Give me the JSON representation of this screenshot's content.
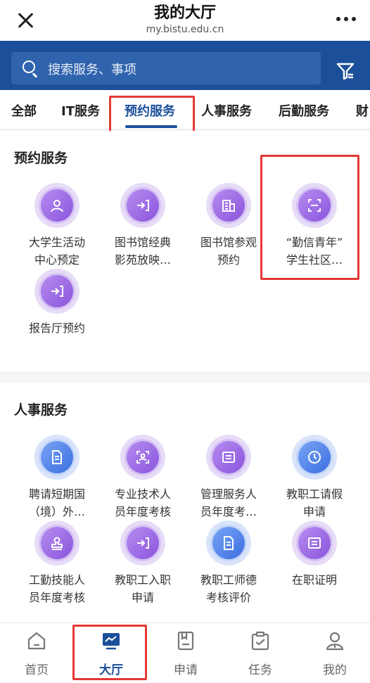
{
  "header": {
    "title": "我的大厅",
    "subtitle": "my.bistu.edu.cn"
  },
  "search": {
    "placeholder": "搜索服务、事项"
  },
  "tabs": [
    {
      "label": "全部"
    },
    {
      "label": "IT服务"
    },
    {
      "label": "预约服务"
    },
    {
      "label": "人事服务"
    },
    {
      "label": "后勤服务"
    },
    {
      "label": "财"
    }
  ],
  "sections": [
    {
      "title": "预约服务",
      "items": [
        {
          "line1": "大学生活动",
          "line2": "中心预定",
          "color": "purple",
          "icon": "person-icon"
        },
        {
          "line1": "图书馆经典",
          "line2": "影苑放映…",
          "color": "purple",
          "icon": "enter-icon"
        },
        {
          "line1": "图书馆参观",
          "line2": "预约",
          "color": "purple",
          "icon": "building-icon"
        },
        {
          "line1": "“勤信青年”",
          "line2": "学生社区…",
          "color": "purple",
          "icon": "scan-icon"
        },
        {
          "line1": "报告厅预约",
          "line2": "",
          "color": "purple",
          "icon": "enter-icon"
        }
      ]
    },
    {
      "title": "人事服务",
      "items": [
        {
          "line1": "聘请短期国",
          "line2": "（境）外…",
          "color": "blue",
          "icon": "document-icon"
        },
        {
          "line1": "专业技术人",
          "line2": "员年度考核",
          "color": "purple",
          "icon": "face-scan-icon"
        },
        {
          "line1": "管理服务人",
          "line2": "员年度考…",
          "color": "purple",
          "icon": "list-card-icon"
        },
        {
          "line1": "教职工请假",
          "line2": "申请",
          "color": "blue",
          "icon": "clock-icon"
        },
        {
          "line1": "工勤技能人",
          "line2": "员年度考核",
          "color": "purple",
          "icon": "stamp-icon"
        },
        {
          "line1": "教职工入职",
          "line2": "申请",
          "color": "purple",
          "icon": "enter-icon"
        },
        {
          "line1": "教职工师德",
          "line2": "考核评价",
          "color": "blue",
          "icon": "document-icon"
        },
        {
          "line1": "在职证明",
          "line2": "",
          "color": "purple",
          "icon": "list-card-icon"
        }
      ]
    }
  ],
  "bottom_nav": [
    {
      "label": "首页",
      "icon": "home-icon"
    },
    {
      "label": "大厅",
      "icon": "hall-icon",
      "active": true
    },
    {
      "label": "申请",
      "icon": "apply-icon"
    },
    {
      "label": "任务",
      "icon": "task-icon"
    },
    {
      "label": "我的",
      "icon": "profile-icon"
    }
  ],
  "colors": {
    "brand_blue": "#1b4f9a",
    "highlight_red": "#e53935"
  }
}
